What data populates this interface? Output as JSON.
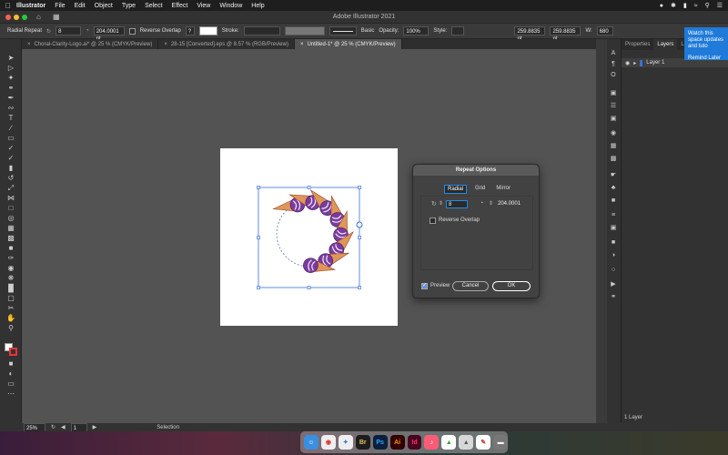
{
  "menubar": {
    "app_name": "Illustrator",
    "items": [
      "File",
      "Edit",
      "Object",
      "Type",
      "Select",
      "Effect",
      "View",
      "Window",
      "Help"
    ]
  },
  "window": {
    "title": "Adobe Illustrator 2021"
  },
  "controlbar": {
    "mode_label": "Radial Repeat",
    "instances_value": "8",
    "radius_value": "204.0001 pt",
    "reverse_overlap_label": "Reverse Overlap",
    "stroke_label": "Stroke:",
    "basic_label": "Basic",
    "opacity_label": "Opacity:",
    "opacity_value": "100%",
    "style_label": "Style:",
    "x_value": "259.8835 pt",
    "y_value": "259.8835 pt",
    "w_label": "W:",
    "w_value": "680"
  },
  "tabs": [
    {
      "label": "Choral-Clarity-Logo.ai* @ 25 % (CMYK/Preview)",
      "active": false
    },
    {
      "label": "28-15 [Converted].eps @ 8.57 % (RGB/Preview)",
      "active": false
    },
    {
      "label": "Untitled-1* @ 25 % (CMYK/Preview)",
      "active": true
    }
  ],
  "panel": {
    "tabs": [
      "Properties",
      "Layers",
      "Libr"
    ],
    "layer_name": "Layer 1",
    "footer": "1 Layer"
  },
  "notification": {
    "text": "Watch this space updates and tuto",
    "action": "Remind Later"
  },
  "statusbar": {
    "zoom": "25%",
    "page": "1",
    "tool": "Selection"
  },
  "dialog": {
    "title": "Repeat Options",
    "modes": [
      "Radial",
      "Grid",
      "Mirror"
    ],
    "active_mode": "Radial",
    "instances_value": "8",
    "radius_value": "204.0001",
    "reverse_overlap_label": "Reverse Overlap",
    "preview_label": "Preview",
    "cancel_label": "Cancel",
    "ok_label": "OK"
  },
  "dock": {
    "apps": [
      "Finder",
      "Chrome",
      "Safari",
      "Bridge",
      "Photoshop",
      "Illustrator",
      "InDesign",
      "Music",
      "Charts",
      "Affinity",
      "Notes",
      "Trash"
    ]
  },
  "colors": {
    "accent": "#1f7ad9",
    "icecream_purple": "#7b3b9e",
    "cone_orange": "#e0955a"
  }
}
